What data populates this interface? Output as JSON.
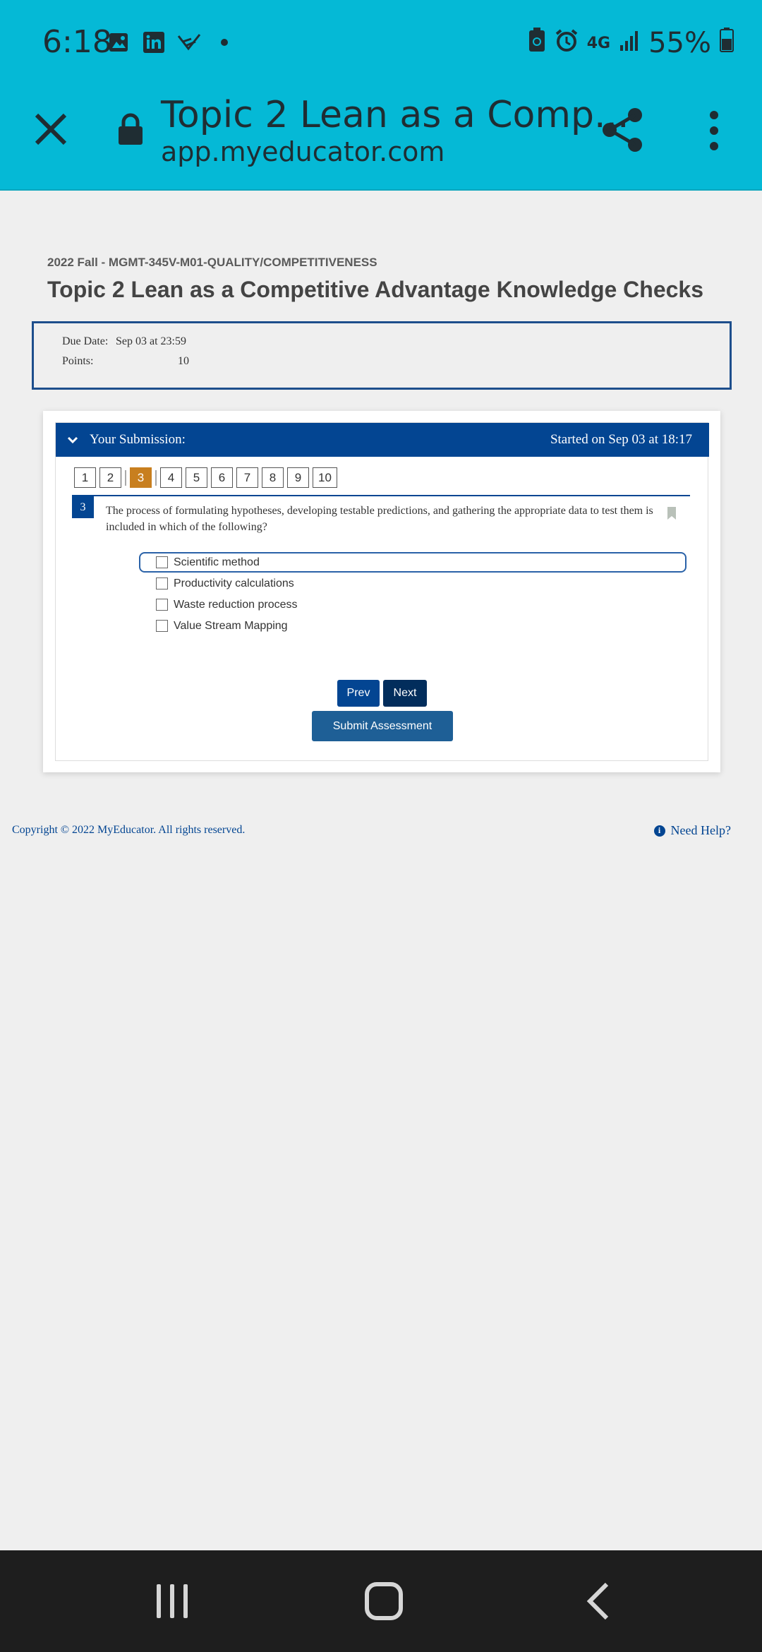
{
  "status_bar": {
    "time": "6:18",
    "network": "4G",
    "battery": "55%",
    "icons": [
      "gallery-icon",
      "linkedin-icon",
      "bird-app-icon",
      "dot-icon",
      "battery-saver-icon",
      "alarm-icon",
      "signal-icon",
      "battery-icon"
    ]
  },
  "browser": {
    "title": "Topic 2 Lean as a Comp...",
    "url": "app.myeducator.com"
  },
  "page": {
    "course": "2022 Fall - MGMT-345V-M01-QUALITY/COMPETITIVENESS",
    "title": "Topic 2 Lean as a Competitive Advantage Knowledge Checks",
    "due_label": "Due Date:",
    "due_value": "Sep 03 at 23:59",
    "points_label": "Points:",
    "points_value": "10"
  },
  "submission": {
    "header_left": "Your Submission:",
    "header_right": "Started on Sep 03 at 18:17",
    "question_numbers": [
      "1",
      "2",
      "3",
      "4",
      "5",
      "6",
      "7",
      "8",
      "9",
      "10"
    ],
    "current_question": "3",
    "question_text": "The process of formulating hypotheses, developing testable predictions, and gathering the appropriate data to test them is included in which of the following?",
    "options": [
      "Scientific method",
      "Productivity calculations",
      "Waste reduction process",
      "Value Stream Mapping"
    ],
    "prev_label": "Prev",
    "next_label": "Next",
    "submit_label": "Submit Assessment"
  },
  "footer": {
    "copyright": "Copyright © 2022 MyEducator. All rights reserved.",
    "help": "Need Help?",
    "help_icon_glyph": "i"
  },
  "colors": {
    "status_bar_bg": "#05b9d6",
    "primary": "#034592",
    "active_question": "#c87f1f",
    "submit": "#1e5f96"
  }
}
